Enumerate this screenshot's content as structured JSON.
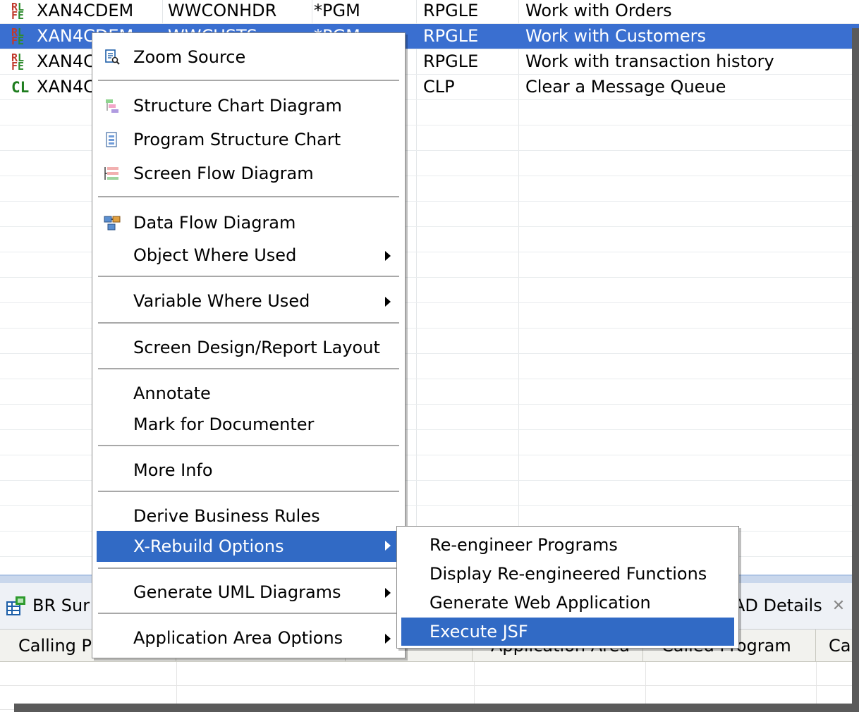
{
  "table": {
    "rows": [
      {
        "type_icon": "rpgle-source-icon",
        "name": "XAN4CDEM",
        "file": "WWCONHDR",
        "type": "*PGM",
        "attribute": "RPGLE",
        "text": "Work with Orders",
        "selected": false
      },
      {
        "type_icon": "rpgle-source-icon",
        "name": "XAN4CDEM",
        "file": "WWCUSTS",
        "type": "*PGM",
        "attribute": "RPGLE",
        "text": "Work with Customers",
        "selected": true
      },
      {
        "type_icon": "rpgle-source-icon",
        "name": "XAN4C",
        "file": "",
        "type": "",
        "attribute": "RPGLE",
        "text": "Work with transaction history",
        "selected": false
      },
      {
        "type_icon": "cl-source-icon",
        "name": "XAN4C",
        "file": "",
        "type": "",
        "attribute": "CLP",
        "text": "Clear a Message Queue",
        "selected": false
      }
    ]
  },
  "bottom_view": {
    "left_tab_label": "BR Sur",
    "right_tab_label": "AD Details",
    "columns": [
      "Calling Pr",
      "",
      "",
      "Application Area",
      "Called Program",
      "Ca"
    ]
  },
  "context_menu": {
    "items": [
      {
        "label": "Zoom Source",
        "icon": "zoom-source-icon"
      },
      {
        "label": "Structure Chart Diagram",
        "icon": "structure-chart-icon"
      },
      {
        "label": "Program Structure Chart",
        "icon": "program-structure-icon"
      },
      {
        "label": "Screen Flow Diagram",
        "icon": "screen-flow-icon"
      },
      {
        "label": "Data Flow Diagram",
        "icon": "data-flow-icon"
      },
      {
        "label": "Object Where Used",
        "submenu": true
      },
      {
        "label": "Variable Where Used",
        "submenu": true
      },
      {
        "label": "Screen Design/Report Layout"
      },
      {
        "label": "Annotate"
      },
      {
        "label": "Mark for Documenter"
      },
      {
        "label": "More Info"
      },
      {
        "label": "Derive Business Rules"
      },
      {
        "label": "X-Rebuild Options",
        "submenu": true,
        "highlighted": true
      },
      {
        "label": "Generate UML Diagrams",
        "submenu": true
      },
      {
        "label": "Application Area Options",
        "submenu": true
      }
    ]
  },
  "submenu": {
    "items": [
      {
        "label": "Re-engineer Programs"
      },
      {
        "label": "Display Re-engineered Functions"
      },
      {
        "label": "Generate Web Application"
      },
      {
        "label": "Execute JSF",
        "highlighted": true
      }
    ]
  },
  "colors": {
    "selection": "#3a6fd0",
    "menu_highlight": "#316ac5"
  }
}
